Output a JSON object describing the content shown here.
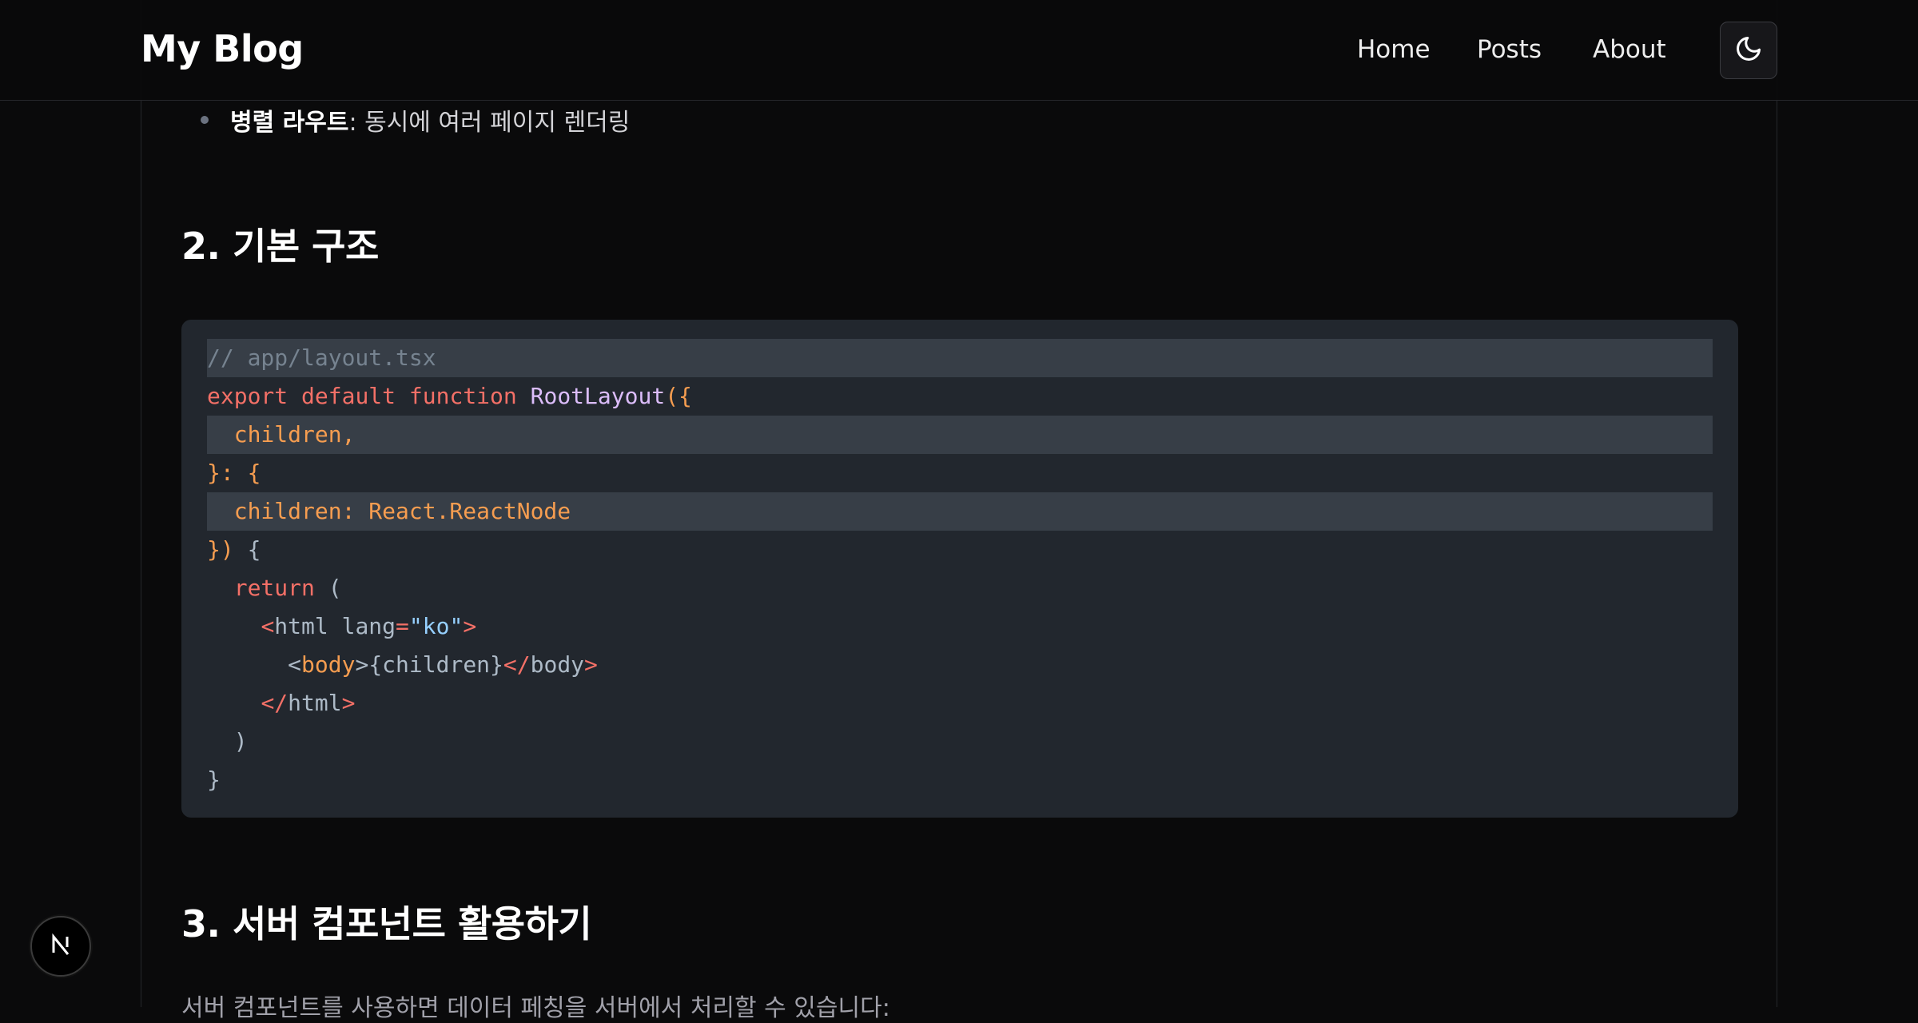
{
  "header": {
    "logo": "My Blog",
    "nav": {
      "home": "Home",
      "posts": "Posts",
      "about": "About"
    },
    "theme_toggle_icon": "moon-icon"
  },
  "article": {
    "bullet": {
      "strong": "병렬 라우트",
      "rest": ": 동시에 여러 페이지 렌더링"
    },
    "section2_title": "2. 기본 구조",
    "code": {
      "l1": "// app/layout.tsx",
      "l2_kw1": "export",
      "l2_kw2": "default",
      "l2_kw3": "function",
      "l2_fn": "RootLayout",
      "l2_tail": "({",
      "l3": "  children,",
      "l4": "}: {",
      "l5": "  children: React.ReactNode",
      "l6_a": "})",
      "l6_b": " {",
      "l7_kw": "return",
      "l7_tail": " (",
      "l8_open": "<",
      "l8_tag": "html",
      "l8_attr": " lang",
      "l8_eq": "=",
      "l8_val": "\"ko\"",
      "l8_close": ">",
      "l9_open": "<",
      "l9_tag": "body",
      "l9_mid1": ">",
      "l9_expr": "{children}",
      "l9_open2": "</",
      "l9_tag2": "body",
      "l9_close": ">",
      "l10_open": "</",
      "l10_tag": "html",
      "l10_close": ">",
      "l11": "  )",
      "l12": "}"
    },
    "section3_title": "3. 서버 컴포넌트 활용하기",
    "bottom_text": "서버 컴포넌트를 사용하면 데이터 페칭을 서버에서 처리할 수 있습니다:"
  },
  "dev_badge": {
    "icon": "nextjs-logo-icon",
    "letter": "N"
  },
  "colors": {
    "background": "#0a0a0b",
    "code_bg": "#22272e",
    "code_highlight": "#373e47",
    "keyword": "#f47067",
    "function": "#dcbdfb",
    "param": "#f69d50",
    "string": "#96d0ff"
  }
}
